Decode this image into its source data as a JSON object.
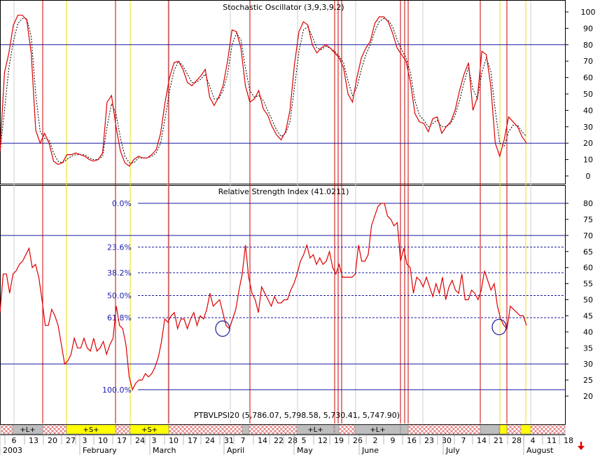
{
  "colors": {
    "price_line": "#dd0000",
    "signal_line": "#000000",
    "level_line": "#1a1aa0",
    "event_red": "#cc0000",
    "event_yellow": "#f2e000",
    "band_gray": "#bdbdbd",
    "band_yellow": "#ffff00",
    "band_hatch": "#e06060",
    "arrow": "#e00000"
  },
  "icons": {
    "scroll_arrow": "red-down-arrow-icon"
  },
  "chart_data": [
    {
      "type": "line",
      "title": "Stochastic Oscillator (3,9,3,9,2)",
      "yticks": [
        0,
        10,
        20,
        30,
        40,
        50,
        60,
        70,
        80,
        90,
        100
      ],
      "ylim": [
        -4,
        104
      ],
      "reference_levels": [
        20,
        80
      ],
      "series": [
        {
          "name": "%K",
          "style": "solid",
          "values": [
            15,
            63,
            75,
            92,
            98,
            98,
            95,
            75,
            28,
            20,
            26,
            20,
            9,
            7,
            8,
            13,
            13,
            14,
            13,
            12,
            10,
            9,
            10,
            14,
            45,
            49,
            30,
            15,
            8,
            6,
            10,
            12,
            11,
            11,
            13,
            16,
            26,
            45,
            60,
            69,
            70,
            65,
            57,
            55,
            58,
            61,
            65,
            48,
            43,
            48,
            55,
            70,
            89,
            88,
            78,
            55,
            45,
            47,
            52,
            41,
            37,
            30,
            25,
            22,
            27,
            40,
            68,
            88,
            94,
            92,
            80,
            75,
            78,
            80,
            78,
            75,
            72,
            66,
            50,
            45,
            60,
            72,
            78,
            82,
            93,
            97,
            97,
            94,
            87,
            78,
            74,
            70,
            57,
            38,
            33,
            32,
            27,
            35,
            36,
            26,
            30,
            33,
            40,
            52,
            62,
            69,
            40,
            48,
            76,
            74,
            55,
            20,
            12,
            22,
            36,
            33,
            30,
            24,
            20
          ]
        },
        {
          "name": "%D",
          "style": "dashed",
          "values": [
            14,
            40,
            66,
            82,
            93,
            96,
            96,
            85,
            50,
            27,
            23,
            22,
            14,
            9,
            8,
            10,
            12,
            13,
            13,
            13,
            11,
            10,
            10,
            12,
            30,
            44,
            38,
            23,
            12,
            8,
            8,
            11,
            11,
            11,
            12,
            14,
            20,
            35,
            52,
            64,
            70,
            67,
            62,
            57,
            57,
            59,
            62,
            55,
            47,
            47,
            52,
            62,
            80,
            87,
            83,
            66,
            52,
            48,
            49,
            46,
            40,
            34,
            28,
            24,
            26,
            33,
            54,
            76,
            89,
            91,
            85,
            78,
            77,
            79,
            78,
            76,
            73,
            69,
            58,
            49,
            54,
            65,
            74,
            80,
            88,
            94,
            96,
            95,
            91,
            83,
            77,
            72,
            63,
            46,
            37,
            34,
            30,
            32,
            34,
            30,
            30,
            32,
            37,
            46,
            57,
            66,
            53,
            47,
            63,
            72,
            64,
            40,
            20,
            18,
            27,
            31,
            31,
            27,
            24
          ]
        }
      ]
    },
    {
      "type": "line",
      "title": "Relative Strength Index (41.0211)",
      "yticks": [
        20,
        25,
        30,
        35,
        40,
        45,
        50,
        55,
        60,
        65,
        70,
        75,
        80
      ],
      "ylim": [
        15.5,
        83
      ],
      "reference_levels": [
        30,
        70
      ],
      "fibonacci": {
        "levels": [
          {
            "label": "0.0%",
            "value": 80
          },
          {
            "label": "23.6%",
            "value": 66.4
          },
          {
            "label": "38.2%",
            "value": 58.4
          },
          {
            "label": "50.0%",
            "value": 51.3
          },
          {
            "label": "61.8%",
            "value": 44.4
          },
          {
            "label": "100.0%",
            "value": 22
          }
        ]
      },
      "circled_points": [
        {
          "date": "2003-03-31",
          "value": 41
        },
        {
          "date": "2003-07-22",
          "value": 41.5
        }
      ],
      "series": [
        {
          "name": "RSI",
          "values": [
            46,
            58,
            58,
            52,
            58,
            59,
            61,
            62,
            64,
            66,
            60,
            61,
            57,
            50,
            42,
            42,
            47,
            45,
            42,
            36,
            30,
            31,
            33,
            38,
            35,
            35,
            38,
            35,
            34,
            38,
            34,
            35,
            37,
            33,
            36,
            38,
            48,
            42,
            41,
            36,
            26,
            22,
            24,
            25,
            25,
            27,
            26,
            27,
            29,
            32,
            37,
            44,
            43,
            45,
            46,
            41,
            44,
            44,
            41,
            44,
            46,
            42,
            45,
            44,
            47,
            52,
            48,
            49,
            50,
            46,
            42,
            41,
            44,
            47,
            53,
            58,
            67,
            57,
            52,
            50,
            46,
            54,
            52,
            50,
            48,
            51,
            49,
            49,
            50,
            50,
            53,
            55,
            58,
            62,
            64,
            67,
            63,
            64,
            61,
            63,
            61,
            62,
            65,
            60,
            58,
            61,
            57,
            57,
            57,
            57,
            58,
            67,
            62,
            62,
            64,
            73,
            76,
            79,
            80,
            80,
            76,
            75,
            73,
            74,
            62,
            66,
            61,
            60,
            52,
            57,
            56,
            54,
            57,
            54,
            51,
            55,
            52,
            57,
            50,
            54,
            56,
            53,
            52,
            58,
            50,
            50,
            53,
            52,
            50,
            53,
            59,
            56,
            53,
            55,
            48,
            44,
            42,
            41,
            48,
            47,
            46,
            45,
            45,
            42
          ]
        }
      ]
    }
  ],
  "axes": {
    "date_labels": [
      "6",
      "13",
      "20",
      "27",
      "3",
      "10",
      "17",
      "24",
      "3",
      "10",
      "17",
      "24",
      "31",
      "7",
      "14",
      "22",
      "28",
      "5",
      "12",
      "19",
      "26",
      "2",
      "9",
      "16",
      "23",
      "30",
      "7",
      "14",
      "21",
      "28",
      "4",
      "11",
      "18"
    ],
    "month_labels": [
      "2003",
      "February",
      "March",
      "April",
      "May",
      "June",
      "July",
      "August"
    ]
  },
  "bands": [
    {
      "label": "+L+"
    },
    {
      "label": "+S+"
    },
    {
      "label": "+S+"
    },
    {
      "label": "+L+"
    },
    {
      "label": "+L+"
    }
  ],
  "price_readout": "PTBVLPSI20 (5,786.07, 5,798.58, 5,730.41, 5,747.90)"
}
